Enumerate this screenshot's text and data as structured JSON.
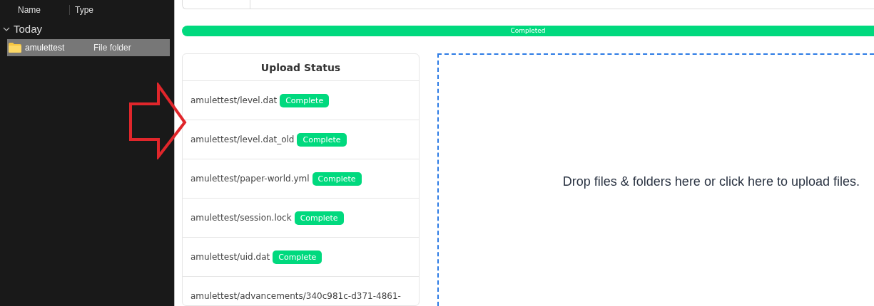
{
  "explorer": {
    "columns": [
      "Name",
      "Type"
    ],
    "group": {
      "label": "Today",
      "expanded": true
    },
    "items": [
      {
        "name": "amulettest",
        "type": "File folder",
        "selected": true
      }
    ]
  },
  "progress": {
    "label": "Completed",
    "level": 1
  },
  "upload_status": {
    "title": "Upload Status",
    "files": [
      {
        "name": "amulettest/level.dat",
        "status": "Complete"
      },
      {
        "name": "amulettest/level.dat_old",
        "status": "Complete"
      },
      {
        "name": "amulettest/paper-world.yml",
        "status": "Complete"
      },
      {
        "name": "amulettest/session.lock",
        "status": "Complete"
      },
      {
        "name": "amulettest/uid.dat",
        "status": "Complete"
      },
      {
        "name": "amulettest/advancements/340c981c-d371-4861-"
      }
    ]
  },
  "dropzone": {
    "text": "Drop files & folders here or click here to upload files."
  }
}
